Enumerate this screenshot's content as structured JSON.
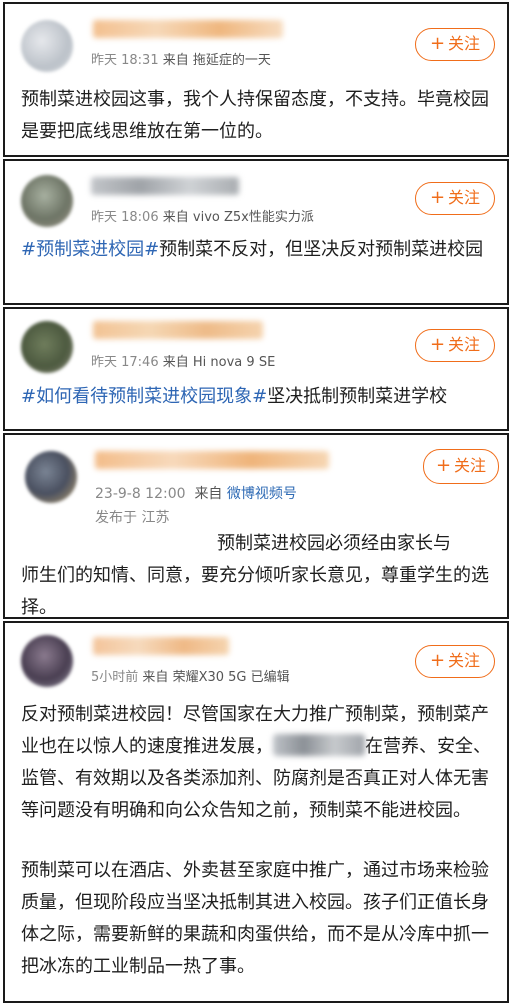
{
  "follow_label": "关注",
  "follow_icon": "plus-icon",
  "posts": [
    {
      "meta_time": "昨天 18:31",
      "meta_from": "来自",
      "meta_source": "拖延症的一天",
      "text": "预制菜进校园这事，我个人持保留态度，不支持。毕竟校园是要把底线思维放在第一位的。"
    },
    {
      "meta_time": "昨天 18:06",
      "meta_from": "来自",
      "meta_source": "vivo Z5x性能实力派",
      "hashtag": "#预制菜进校园#",
      "text": "预制菜不反对，但坚决反对预制菜进校园"
    },
    {
      "meta_time": "昨天 17:46",
      "meta_from": "来自",
      "meta_source": "Hi nova 9 SE",
      "hashtag": "#如何看待预制菜进校园现象#",
      "text": "坚决抵制预制菜进学校"
    },
    {
      "meta_time": "23-9-8 12:00",
      "meta_from": "来自",
      "meta_source": "微博视频号",
      "location": "发布于 江苏",
      "text_line1": "预制菜进校园必须经由家长与",
      "text_rest": "师生们的知情、同意，要充分倾听家长意见，尊重学生的选择。"
    },
    {
      "meta_time": "5小时前",
      "meta_from": "来自",
      "meta_source": "荣耀X30 5G 已编辑",
      "text_p1a": "反对预制菜进校园！尽管国家在大力推广预制菜，预制菜产业也在以惊人的速度推进发展，",
      "text_p1b": "在营养、安全、监管、有效期以及各类添加剂、防腐剂是否真正对人体无害等问题没有明确和向公众告知之前，预制菜不能进校园。",
      "text_p2": "预制菜可以在酒店、外卖甚至家庭中推广，通过市场来检验质量，但现阶段应当坚决抵制其进入校园。孩子们正值长身体之际，需要新鲜的果蔬和肉蛋供给，而不是从冷库中抓一把冰冻的工业制品一热了事。"
    }
  ],
  "colors": {
    "accent": "#f06d1a",
    "hashtag": "#2e66b4",
    "meta": "#888888",
    "border": "#1a1a1a"
  }
}
